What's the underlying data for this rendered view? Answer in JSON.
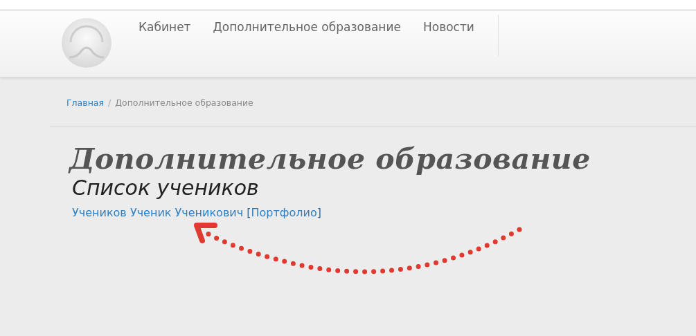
{
  "navbar": {
    "items": [
      {
        "label": "Кабинет",
        "selected": false
      },
      {
        "label": "Дополнительное образование",
        "selected": false
      },
      {
        "label": "Новости",
        "selected": false
      }
    ]
  },
  "breadcrumb_separator": "/",
  "breadcrumb": [
    {
      "label": "Главная",
      "kind": "link"
    },
    {
      "label": "Дополнительное образование",
      "kind": "current"
    }
  ],
  "page_title": "Дополнительное образование",
  "section_title": "Список учеников",
  "students": [
    {
      "name": "Учеников Ученик Ученикович",
      "open_bracket": "[",
      "portfolio_link": "Портфолио",
      "close_bracket": "]"
    }
  ]
}
